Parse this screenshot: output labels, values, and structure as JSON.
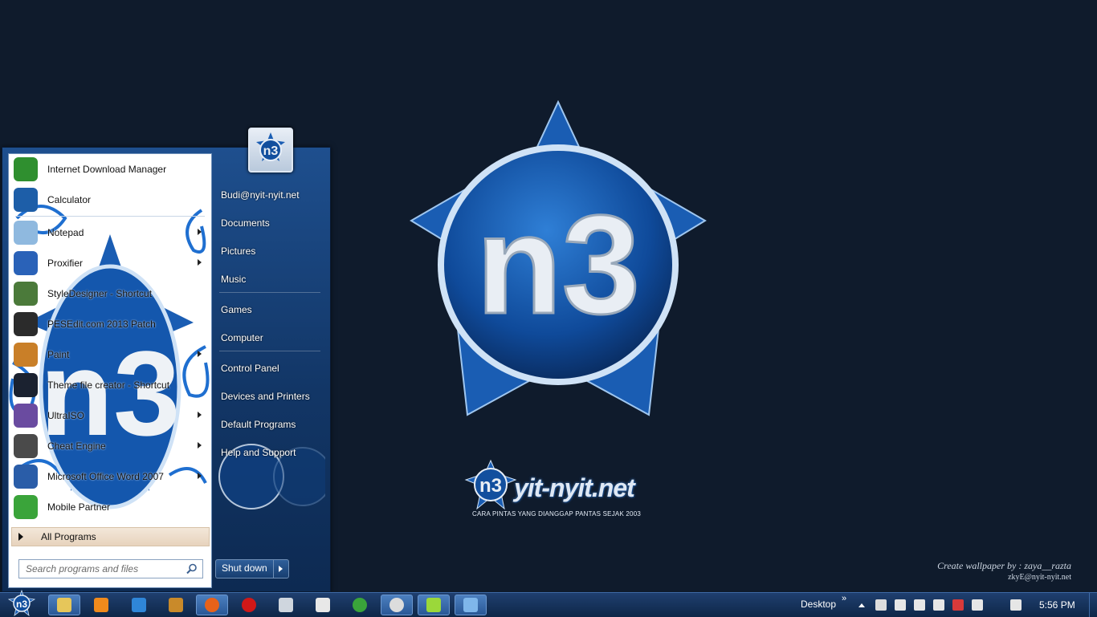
{
  "wallpaper": {
    "brand_name": "yit-nyit.net",
    "tagline": "CARA PINTAS YANG DIANGGAP PANTAS SEJAK 2003",
    "credit_line1": "Create wallpaper by : zaya__razta",
    "credit_line2": "zkyE@nyit-nyit.net",
    "logo_letters": "n3"
  },
  "start_menu": {
    "programs": [
      {
        "label": "Internet Download Manager",
        "icon": "idm-globe-icon",
        "color": "#2f8f2f",
        "arrow": false
      },
      {
        "label": "Calculator",
        "icon": "calculator-icon",
        "color": "#1d5ea8",
        "arrow": false
      },
      {
        "label": "Notepad",
        "icon": "notepad-icon",
        "color": "#8fb9df",
        "arrow": true
      },
      {
        "label": "Proxifier",
        "icon": "proxifier-icon",
        "color": "#2a62b8",
        "arrow": true
      },
      {
        "label": "StyleDesigner - Shortcut",
        "icon": "style-designer-icon",
        "color": "#4b7a3a",
        "arrow": false
      },
      {
        "label": "PESEdit.com 2013 Patch",
        "icon": "pesedit-icon",
        "color": "#2b2b2b",
        "arrow": false
      },
      {
        "label": "Paint",
        "icon": "paint-icon",
        "color": "#c97f28",
        "arrow": true
      },
      {
        "label": "Theme file creator - Shortcut",
        "icon": "theme-creator-icon",
        "color": "#1b2230",
        "arrow": false
      },
      {
        "label": "UltraISO",
        "icon": "ultraiso-icon",
        "color": "#6a4ba0",
        "arrow": true
      },
      {
        "label": "Cheat Engine",
        "icon": "cheat-engine-icon",
        "color": "#4a4a4a",
        "arrow": true
      },
      {
        "label": "Microsoft Office Word 2007",
        "icon": "word-icon",
        "color": "#2a5da8",
        "arrow": true
      },
      {
        "label": "Mobile Partner",
        "icon": "mobile-partner-icon",
        "color": "#3aa43a",
        "arrow": false
      }
    ],
    "all_programs": "All Programs",
    "search_placeholder": "Search programs and files",
    "right_items": [
      {
        "label": "Budi@nyit-nyit.net",
        "name": "user-folder"
      },
      {
        "label": "Documents",
        "name": "documents"
      },
      {
        "label": "Pictures",
        "name": "pictures"
      },
      {
        "label": "Music",
        "name": "music"
      },
      {
        "label": "Games",
        "name": "games"
      },
      {
        "label": "Computer",
        "name": "computer"
      },
      {
        "label": "Control Panel",
        "name": "control-panel"
      },
      {
        "label": "Devices and Printers",
        "name": "devices-and-printers"
      },
      {
        "label": "Default Programs",
        "name": "default-programs"
      },
      {
        "label": "Help and Support",
        "name": "help-and-support"
      }
    ],
    "shutdown_label": "Shut down"
  },
  "taskbar": {
    "apps": [
      {
        "name": "explorer",
        "icon": "folder-icon",
        "color": "#e6c65a",
        "active": true
      },
      {
        "name": "media-player",
        "icon": "media-player-icon",
        "color": "#f08a1c",
        "active": false
      },
      {
        "name": "internet-explorer",
        "icon": "ie-icon",
        "color": "#2f86d8",
        "active": false
      },
      {
        "name": "photo-app",
        "icon": "photo-icon",
        "color": "#c98a2a",
        "active": false
      },
      {
        "name": "firefox",
        "icon": "firefox-icon",
        "color": "#e8621a",
        "active": true
      },
      {
        "name": "opera",
        "icon": "opera-icon",
        "color": "#d01818",
        "active": false
      },
      {
        "name": "tool",
        "icon": "tool-icon",
        "color": "#cfd6de",
        "active": false
      },
      {
        "name": "movie-maker",
        "icon": "movie-icon",
        "color": "#e8e8e8",
        "active": false
      },
      {
        "name": "chrome",
        "icon": "chrome-icon",
        "color": "#3aa43a",
        "active": false
      },
      {
        "name": "app-face",
        "icon": "face-icon",
        "color": "#dcdcdc",
        "active": true
      },
      {
        "name": "app-wave",
        "icon": "wave-icon",
        "color": "#9bd83a",
        "active": true
      },
      {
        "name": "remote-desktop",
        "icon": "monitor-icon",
        "color": "#7fb6ea",
        "active": true
      }
    ],
    "toolbar_label": "Desktop",
    "chevron": "»",
    "tray_icons": [
      {
        "name": "tray-face",
        "color": "#dddddd"
      },
      {
        "name": "tray-network-a",
        "color": "#e6e6e6"
      },
      {
        "name": "tray-network-b",
        "color": "#e6e6e6"
      },
      {
        "name": "tray-network-c",
        "color": "#e6e6e6"
      },
      {
        "name": "tray-action-center",
        "color": "#d83a3a"
      },
      {
        "name": "tray-volume",
        "color": "#e6e6e6"
      },
      {
        "name": "tray-power",
        "color": "#e6e6e6"
      }
    ],
    "clock": "5:56 PM"
  }
}
